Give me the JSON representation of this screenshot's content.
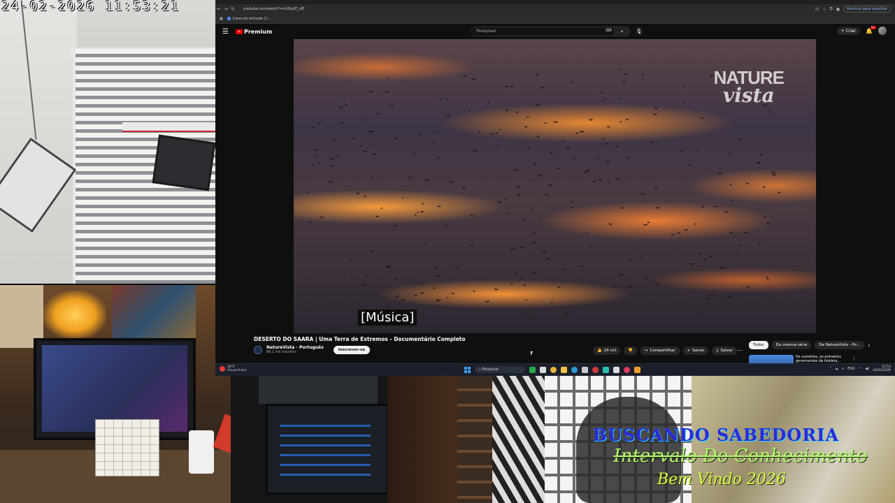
{
  "overlay": {
    "timestamp": "24-02-2026 11:53:21",
    "stream_title": "BUSCANDO SABEDORIA",
    "stream_subtitle": "Intervalo Do Conhecimento",
    "stream_welcome": "Bem Vindo 2026"
  },
  "browser": {
    "url": "youtube.com/watch?v=LQkyfZ_vIE",
    "bookmark": "Caixa de entrada (1...",
    "update_button": "Reiniciar para atualizar"
  },
  "youtube": {
    "logo_text": "Premium",
    "search_placeholder": "Pesquisar",
    "create_label": "+ Criar",
    "notification_count": "9+",
    "caption": "[Música]",
    "watermark_line1": "NATURE",
    "watermark_line2": "vista",
    "video_title": "DESERTO DO SAARA | Uma Terra de Extremos - Documentário Completo",
    "channel_name": "NatureVista - Português",
    "channel_subs": "68,1 mil inscritos",
    "subscribe_label": "Inscrever-se",
    "likes": "24 mil",
    "share_label": "Compartilhar",
    "save_label": "Salvar",
    "save_list_label": "Salvar",
    "chips": [
      "Todos",
      "Da mesma série",
      "De NatureVista - Po..."
    ],
    "rec_title": "Os sumérios, os primeiros governantes da história..."
  },
  "taskbar": {
    "weather_temp": "26°C",
    "weather_desc": "Chuva fraca",
    "search_label": "Pesquisar",
    "lang": "ENG",
    "time": "11:53",
    "date": "24/02/2026"
  },
  "colors": {
    "youtube_red": "#ff0000",
    "overlay_blue": "#2a2ad8",
    "overlay_green": "#b6ff6a"
  }
}
